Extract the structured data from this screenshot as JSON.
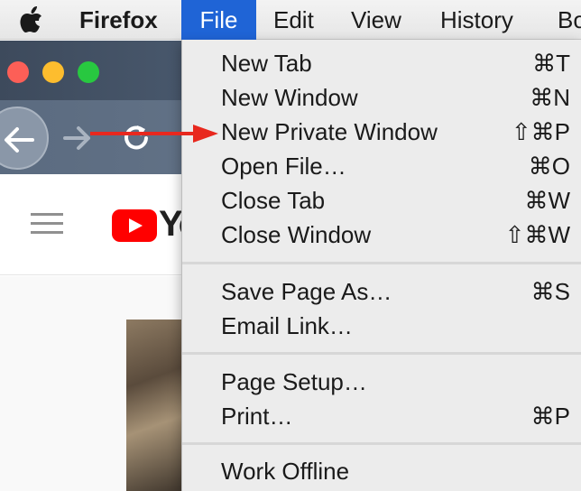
{
  "menubar": {
    "app": "Firefox",
    "items": [
      "File",
      "Edit",
      "View",
      "History",
      "Bo"
    ]
  },
  "youtube": {
    "logo_text": "Yo"
  },
  "file_menu": {
    "items": [
      {
        "label": "New Tab",
        "shortcut": "⌘T"
      },
      {
        "label": "New Window",
        "shortcut": "⌘N"
      },
      {
        "label": "New Private Window",
        "shortcut": "⇧⌘P"
      },
      {
        "label": "Open File…",
        "shortcut": "⌘O"
      },
      {
        "label": "Close Tab",
        "shortcut": "⌘W"
      },
      {
        "label": "Close Window",
        "shortcut": "⇧⌘W"
      },
      {
        "label": "Save Page As…",
        "shortcut": "⌘S"
      },
      {
        "label": "Email Link…",
        "shortcut": ""
      },
      {
        "label": "Page Setup…",
        "shortcut": ""
      },
      {
        "label": "Print…",
        "shortcut": "⌘P"
      },
      {
        "label": "Work Offline",
        "shortcut": ""
      }
    ]
  },
  "colors": {
    "menu_highlight": "#1f64d6",
    "annotation_arrow": "#e8281e",
    "youtube_red": "#ff0000"
  }
}
